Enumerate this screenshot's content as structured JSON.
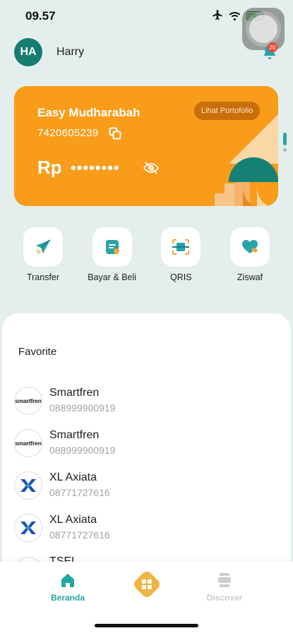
{
  "status": {
    "time": "09.57"
  },
  "header": {
    "avatar_initials": "HA",
    "user_name": "Harry",
    "notification_count": "20"
  },
  "card": {
    "title": "Easy Mudharabah",
    "account_number": "7420605239",
    "portfolio_label": "Lihat Portofolio",
    "currency": "Rp",
    "balance_masked": "••••••••",
    "color": "#f89c19"
  },
  "quick_actions": [
    {
      "label": "Transfer",
      "icon": "paper-plane-icon"
    },
    {
      "label": "Bayar & Beli",
      "icon": "bill-icon"
    },
    {
      "label": "QRIS",
      "icon": "qr-scan-icon"
    },
    {
      "label": "Ziswaf",
      "icon": "heart-hand-icon"
    }
  ],
  "favorites": {
    "title": "Favorite",
    "items": [
      {
        "name": "Smartfren",
        "number": "088999900919",
        "logo": "smartfren"
      },
      {
        "name": "Smartfren",
        "number": "088999900919",
        "logo": "smartfren"
      },
      {
        "name": "XL Axiata",
        "number": "08771727616",
        "logo": "xl"
      },
      {
        "name": "XL Axiata",
        "number": "08771727616",
        "logo": "xl"
      }
    ],
    "partial_item_name": "TSEL"
  },
  "smartfren_logo_text": "smartfren",
  "bottom_nav": {
    "home_label": "Beranda",
    "discover_label": "Discover",
    "accent": "#23a6a3",
    "center_color": "#f0b440"
  }
}
